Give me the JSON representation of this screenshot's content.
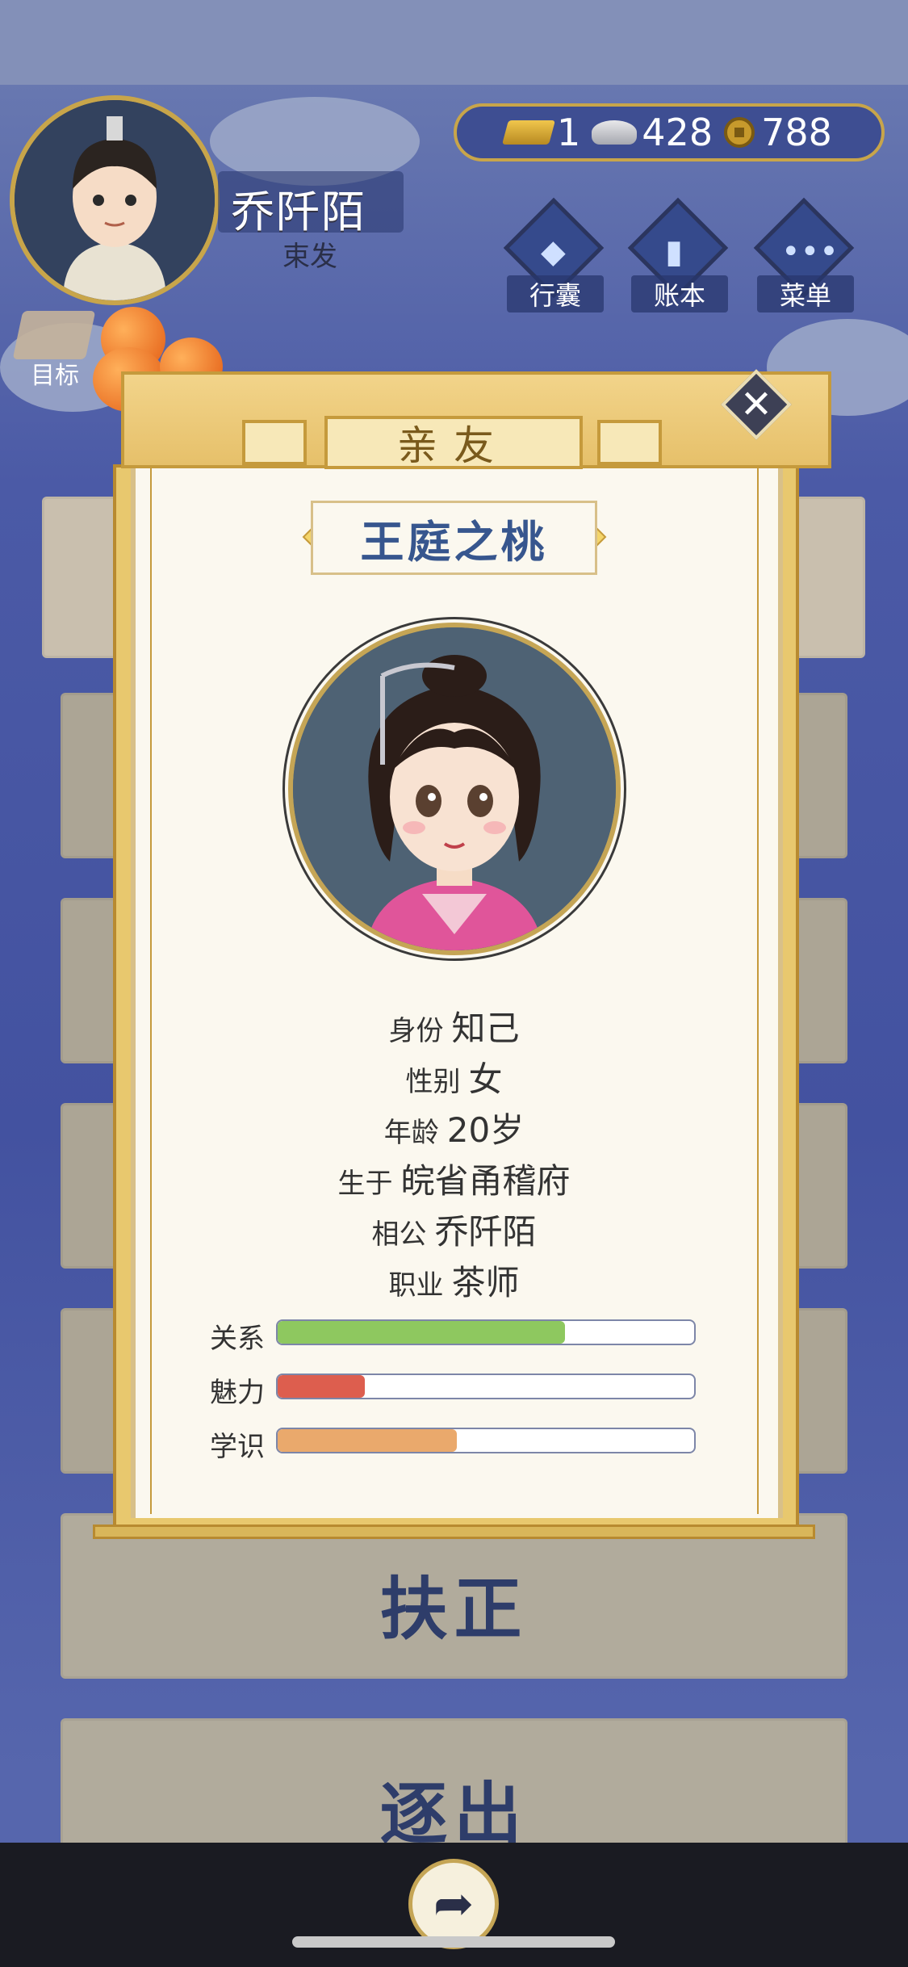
{
  "player": {
    "name": "乔阡陌",
    "hairstyle": "束发"
  },
  "currency": {
    "gold": "1",
    "silver": "428",
    "copper": "788"
  },
  "nav": {
    "bag": "行囊",
    "ledger": "账本",
    "menu": "菜单",
    "goal": "目标"
  },
  "background_buttons": {
    "promote": "扶正",
    "expel": "逐出"
  },
  "modal": {
    "title": "亲友",
    "friend_name": "王庭之桃",
    "fields": [
      {
        "label": "身份",
        "value": "知己"
      },
      {
        "label": "性别",
        "value": "女"
      },
      {
        "label": "年龄",
        "value": "20岁"
      },
      {
        "label": "生于",
        "value": "皖省甬稽府"
      },
      {
        "label": "相公",
        "value": "乔阡陌"
      },
      {
        "label": "职业",
        "value": "茶师"
      }
    ],
    "stats": [
      {
        "label": "关系",
        "fraction": 0.69,
        "color": "#8ec85f"
      },
      {
        "label": "魅力",
        "fraction": 0.21,
        "color": "#dd5e4e"
      },
      {
        "label": "学识",
        "fraction": 0.43,
        "color": "#eaa96c"
      }
    ]
  },
  "icons": {
    "close": "close-icon",
    "share": "share-icon",
    "gold": "gold-ingot-icon",
    "silver": "silver-ingot-icon",
    "copper": "copper-coin-icon"
  }
}
